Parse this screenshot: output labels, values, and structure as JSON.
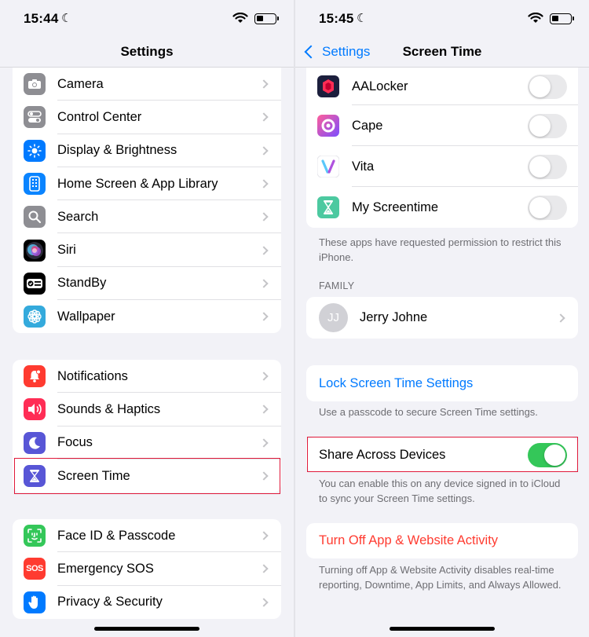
{
  "colors": {
    "accent": "#007aff",
    "destructive": "#ff3b30",
    "toggle_on": "#34c759",
    "highlight": "#e0193a"
  },
  "left": {
    "status": {
      "time": "15:44"
    },
    "nav": {
      "title": "Settings"
    },
    "group1": [
      {
        "label": "Camera",
        "icon": "camera-icon",
        "color": "#8e8e93"
      },
      {
        "label": "Control Center",
        "icon": "toggles-icon",
        "color": "#8e8e93"
      },
      {
        "label": "Display & Brightness",
        "icon": "sun-icon",
        "color": "#007aff"
      },
      {
        "label": "Home Screen & App Library",
        "icon": "phone-grid-icon",
        "color": "#0a84ff"
      },
      {
        "label": "Search",
        "icon": "magnifier-icon",
        "color": "#8e8e93"
      },
      {
        "label": "Siri",
        "icon": "siri-icon",
        "color": "#1c1c1e"
      },
      {
        "label": "StandBy",
        "icon": "standby-icon",
        "color": "#000000"
      },
      {
        "label": "Wallpaper",
        "icon": "flower-icon",
        "color": "#34aadc"
      }
    ],
    "group2": [
      {
        "label": "Notifications",
        "icon": "bell-icon",
        "color": "#ff3b30"
      },
      {
        "label": "Sounds & Haptics",
        "icon": "speaker-icon",
        "color": "#ff2d55"
      },
      {
        "label": "Focus",
        "icon": "moon-icon",
        "color": "#5856d6"
      },
      {
        "label": "Screen Time",
        "icon": "hourglass-icon",
        "color": "#5856d6"
      }
    ],
    "group3": [
      {
        "label": "Face ID & Passcode",
        "icon": "faceid-icon",
        "color": "#34c759"
      },
      {
        "label": "Emergency SOS",
        "icon": "sos-icon",
        "color": "#ff3b30",
        "text": "SOS"
      },
      {
        "label": "Privacy & Security",
        "icon": "hand-icon",
        "color": "#007aff"
      }
    ]
  },
  "right": {
    "status": {
      "time": "15:45"
    },
    "nav": {
      "back_label": "Settings",
      "title": "Screen Time"
    },
    "apps": [
      {
        "label": "AALocker",
        "icon": "aalocker-icon",
        "on": false
      },
      {
        "label": "Cape",
        "icon": "cape-icon",
        "on": false
      },
      {
        "label": "Vita",
        "icon": "vita-icon",
        "on": false
      },
      {
        "label": "My Screentime",
        "icon": "my-screentime-icon",
        "on": false
      }
    ],
    "apps_note": "These apps have requested permission to restrict this iPhone.",
    "family_header": "FAMILY",
    "family_member": {
      "initials": "JJ",
      "name": "Jerry Johne"
    },
    "lock_label": "Lock Screen Time Settings",
    "lock_note": "Use a passcode to secure Screen Time settings.",
    "share_label": "Share Across Devices",
    "share_on": true,
    "share_note": "You can enable this on any device signed in to iCloud to sync your Screen Time settings.",
    "turn_off_label": "Turn Off App & Website Activity",
    "turn_off_note": "Turning off App & Website Activity disables real-time reporting, Downtime, App Limits, and Always Allowed."
  }
}
